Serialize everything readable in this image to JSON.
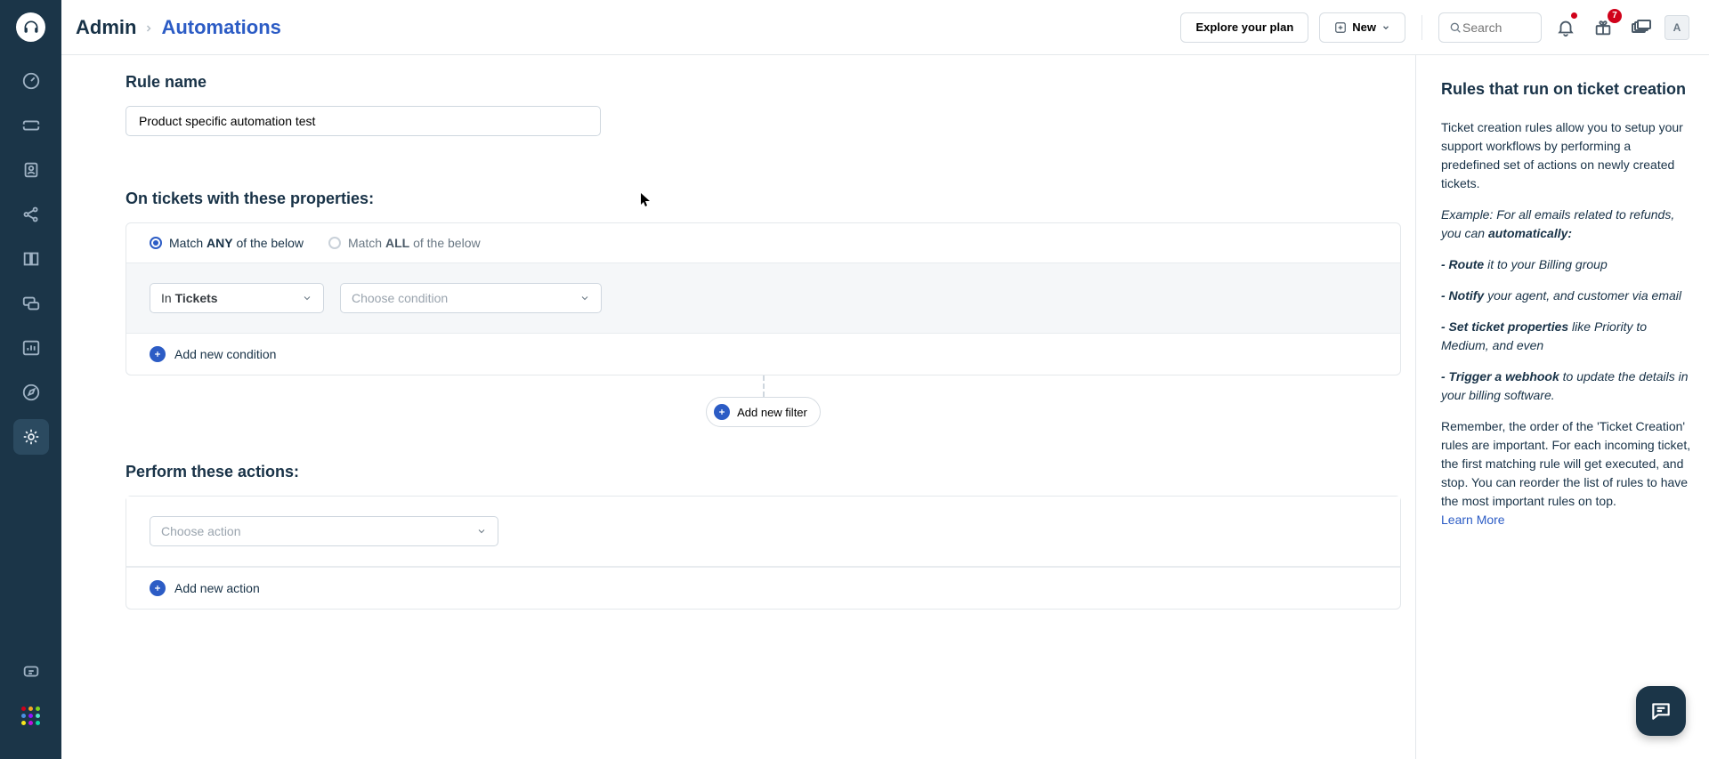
{
  "breadcrumb": {
    "root": "Admin",
    "current": "Automations"
  },
  "header": {
    "explore": "Explore your plan",
    "new": "New",
    "search_placeholder": "Search",
    "gift_badge": "7",
    "avatar": "A"
  },
  "rule": {
    "name_label": "Rule name",
    "name_value": "Product specific automation test",
    "conditions_title": "On tickets with these properties:",
    "match_any_pre": "Match ",
    "match_any_key": "ANY",
    "match_any_post": " of the below",
    "match_all_pre": "Match ",
    "match_all_key": "ALL",
    "match_all_post": " of the below",
    "scope_prefix": "In ",
    "scope_value": "Tickets",
    "choose_condition": "Choose condition",
    "add_condition": "Add new condition",
    "add_filter": "Add new filter",
    "actions_title": "Perform these actions:",
    "choose_action": "Choose action",
    "add_action": "Add new action"
  },
  "help": {
    "title": "Rules that run on ticket creation",
    "intro": "Ticket creation rules allow you to setup your support workflows by performing a predefined set of actions on newly created tickets.",
    "example_pre": "Example: For all emails related to refunds, you can ",
    "example_bold": "automatically:",
    "route_b": "- Route",
    "route_t": " it to your Billing group",
    "notify_b": "- Notify",
    "notify_t": " your agent, and customer via email",
    "set_b": "- Set ticket properties",
    "set_t": " like Priority to Medium, and even",
    "trigger_b": "- Trigger a webhook",
    "trigger_t": " to update the details in your billing software.",
    "closing": "Remember, the order of the 'Ticket Creation' rules are important. For each incoming ticket, the first matching rule will get executed, and stop. You can reorder the list of rules to have the most important rules on top.",
    "learn_more": "Learn More"
  }
}
